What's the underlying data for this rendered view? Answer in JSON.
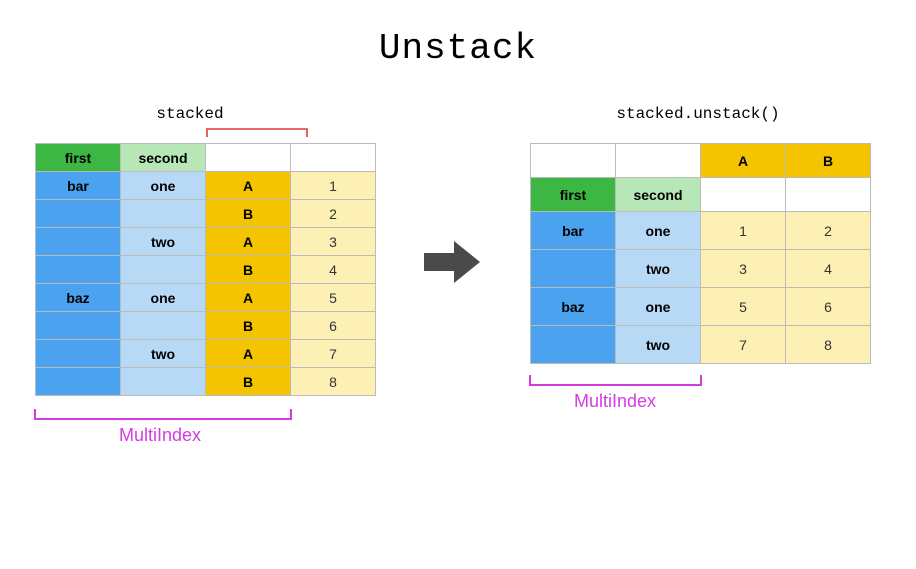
{
  "title": "Unstack",
  "left": {
    "label": "stacked",
    "header": {
      "first": "first",
      "second": "second"
    },
    "rows": [
      {
        "first": "bar",
        "second": "one",
        "col": "A",
        "val": "1"
      },
      {
        "first": "",
        "second": "",
        "col": "B",
        "val": "2"
      },
      {
        "first": "",
        "second": "two",
        "col": "A",
        "val": "3"
      },
      {
        "first": "",
        "second": "",
        "col": "B",
        "val": "4"
      },
      {
        "first": "baz",
        "second": "one",
        "col": "A",
        "val": "5"
      },
      {
        "first": "",
        "second": "",
        "col": "B",
        "val": "6"
      },
      {
        "first": "",
        "second": "two",
        "col": "A",
        "val": "7"
      },
      {
        "first": "",
        "second": "",
        "col": "B",
        "val": "8"
      }
    ],
    "multiindex_label": "MultiIndex"
  },
  "right": {
    "label": "stacked.unstack()",
    "cols": {
      "a": "A",
      "b": "B"
    },
    "header": {
      "first": "first",
      "second": "second"
    },
    "rows": [
      {
        "first": "bar",
        "second": "one",
        "a": "1",
        "b": "2"
      },
      {
        "first": "",
        "second": "two",
        "a": "3",
        "b": "4"
      },
      {
        "first": "baz",
        "second": "one",
        "a": "5",
        "b": "6"
      },
      {
        "first": "",
        "second": "two",
        "a": "7",
        "b": "8"
      }
    ],
    "multiindex_label": "MultiIndex"
  },
  "chart_data": {
    "type": "table",
    "description": "Pandas unstack operation converting a stacked Series with 3-level MultiIndex into a DataFrame with 2-level MultiIndex and columns A,B",
    "stacked": {
      "index_names": [
        "first",
        "second",
        ""
      ],
      "data": [
        [
          "bar",
          "one",
          "A",
          1
        ],
        [
          "bar",
          "one",
          "B",
          2
        ],
        [
          "bar",
          "two",
          "A",
          3
        ],
        [
          "bar",
          "two",
          "B",
          4
        ],
        [
          "baz",
          "one",
          "A",
          5
        ],
        [
          "baz",
          "one",
          "B",
          6
        ],
        [
          "baz",
          "two",
          "A",
          7
        ],
        [
          "baz",
          "two",
          "B",
          8
        ]
      ]
    },
    "unstacked": {
      "index_names": [
        "first",
        "second"
      ],
      "columns": [
        "A",
        "B"
      ],
      "data": [
        [
          "bar",
          "one",
          1,
          2
        ],
        [
          "bar",
          "two",
          3,
          4
        ],
        [
          "baz",
          "one",
          5,
          6
        ],
        [
          "baz",
          "two",
          7,
          8
        ]
      ]
    }
  }
}
